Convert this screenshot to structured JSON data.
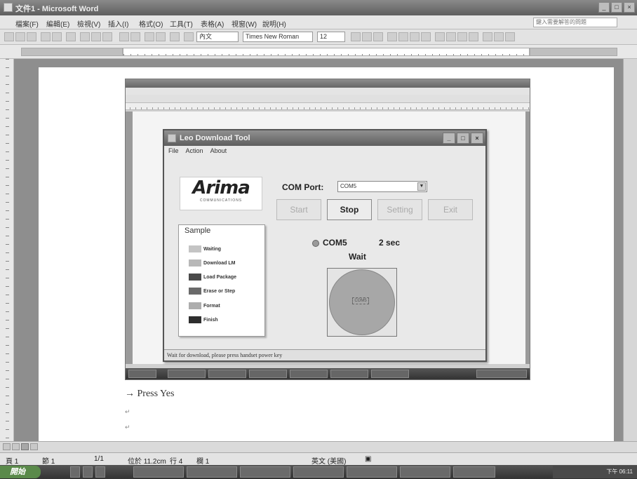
{
  "outer": {
    "title": "文件1 - Microsoft Word",
    "menus": [
      "檔案(F)",
      "編輯(E)",
      "檢視(V)",
      "插入(I)",
      "格式(O)",
      "工具(T)",
      "表格(A)",
      "視窗(W)",
      "說明(H)"
    ],
    "help_placeholder": "鍵入需要解答的問題",
    "style_dropdown": "內文",
    "font_dropdown": "Times New Roman",
    "size_dropdown": "12"
  },
  "dialog": {
    "title": "Leo Download Tool",
    "menu": [
      "File",
      "Action",
      "About"
    ],
    "logo_text": "Arima",
    "logo_sub": "COMMUNICATIONS",
    "com_label": "COM Port:",
    "com_value": "COM5",
    "buttons": {
      "start": "Start",
      "stop": "Stop",
      "setting": "Setting",
      "exit": "Exit"
    },
    "sample": {
      "title": "Sample",
      "items": [
        {
          "label": "Waiting",
          "color": "#c4c4c4"
        },
        {
          "label": "Download LM",
          "color": "#b8b8b8"
        },
        {
          "label": "Load Package",
          "color": "#4a4a4a"
        },
        {
          "label": "Erase or Step",
          "color": "#6a6a6a"
        },
        {
          "label": "Format",
          "color": "#adadad"
        },
        {
          "label": "Finish",
          "color": "#2e2e2e"
        }
      ]
    },
    "status_port": "COM5",
    "status_time": "2 sec",
    "status_text": "Wait",
    "circle_label": "COM5",
    "status_bar": "Wait for download, please press handset power key"
  },
  "document": {
    "line1": "→ Press Yes"
  },
  "statusbar": {
    "page": "頁 1",
    "section": "節 1",
    "pages": "1/1",
    "position": "位於 11.2cm",
    "line": "行 4",
    "column": "欄 1",
    "lang": "英文 (美國)"
  },
  "taskbar": {
    "start": "開始",
    "clock": "下午 06:11"
  }
}
